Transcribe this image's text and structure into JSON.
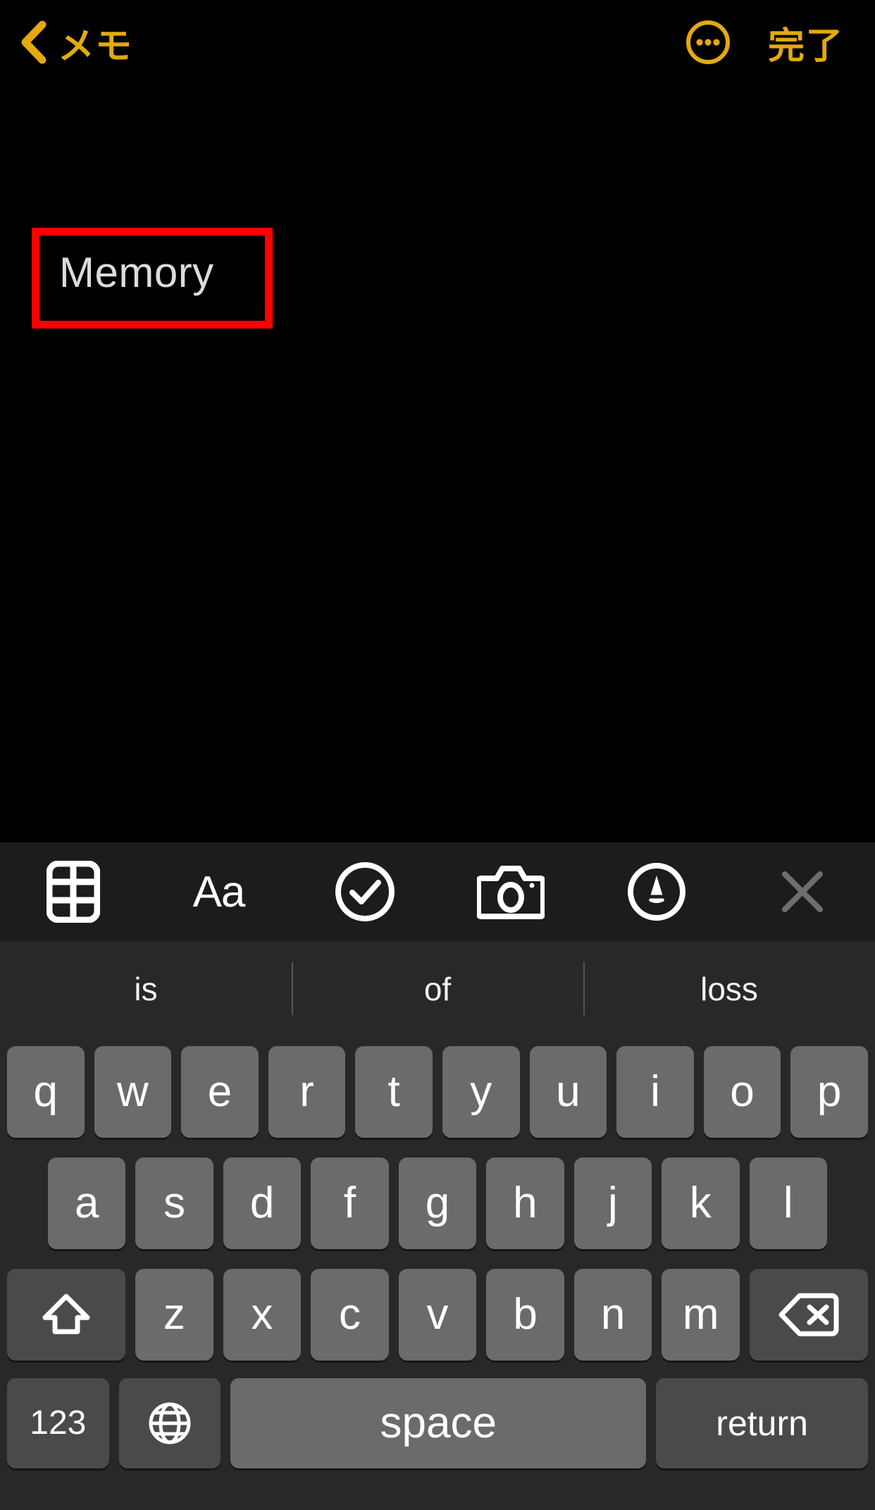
{
  "navbar": {
    "back_label": "メモ",
    "back_icon": "chevron-left-icon",
    "more_icon": "more-circle-icon",
    "done_label": "完了",
    "accent_color": "#E3A90E"
  },
  "note": {
    "title": "Memory",
    "highlight_color": "#FF0000",
    "text_color": "#DCDCDC",
    "background": "#000000"
  },
  "format_toolbar": {
    "background": "#1C1C1E",
    "items": [
      {
        "name": "table-icon",
        "label": ""
      },
      {
        "name": "format-aa-icon",
        "label": "Aa"
      },
      {
        "name": "checklist-icon",
        "label": ""
      },
      {
        "name": "camera-icon",
        "label": ""
      },
      {
        "name": "markup-pen-icon",
        "label": ""
      },
      {
        "name": "close-icon",
        "label": ""
      }
    ]
  },
  "predictive": {
    "background": "#282828",
    "suggestions": [
      "is",
      "of",
      "loss"
    ]
  },
  "keyboard": {
    "background": "#282828",
    "key_color": "#6B6B6B",
    "func_key_color": "#4A4A4A",
    "row1": [
      "q",
      "w",
      "e",
      "r",
      "t",
      "y",
      "u",
      "i",
      "o",
      "p"
    ],
    "row2": [
      "a",
      "s",
      "d",
      "f",
      "g",
      "h",
      "j",
      "k",
      "l"
    ],
    "row3": [
      "z",
      "x",
      "c",
      "v",
      "b",
      "n",
      "m"
    ],
    "shift_icon": "shift-arrow-icon",
    "delete_icon": "delete-backspace-icon",
    "numbers_label": "123",
    "globe_icon": "globe-icon",
    "space_label": "space",
    "return_label": "return"
  }
}
